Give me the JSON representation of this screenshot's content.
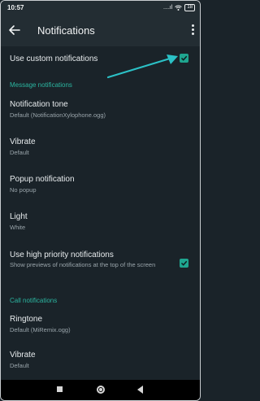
{
  "status": {
    "time": "10:57",
    "signal": "....ıl",
    "battery": "18"
  },
  "appbar": {
    "title": "Notifications"
  },
  "custom": {
    "label": "Use custom notifications",
    "checked": true
  },
  "message_section": {
    "title": "Message notifications"
  },
  "tone": {
    "label": "Notification tone",
    "value": "Default (NotificationXylophone.ogg)"
  },
  "vibrate": {
    "label": "Vibrate",
    "value": "Default"
  },
  "popup": {
    "label": "Popup notification",
    "value": "No popup"
  },
  "light": {
    "label": "Light",
    "value": "White"
  },
  "priority": {
    "label": "Use high priority notifications",
    "value": "Show previews of notifications at the top of the screen",
    "checked": true
  },
  "call_section": {
    "title": "Call notifications"
  },
  "ringtone": {
    "label": "Ringtone",
    "value": "Default (MiRemix.ogg)"
  },
  "call_vibrate": {
    "label": "Vibrate",
    "value": "Default"
  },
  "colors": {
    "accent": "#1fa58f",
    "annotation_arrow": "#2bc1c6",
    "background": "#1a2329",
    "appbar": "#232d33"
  },
  "icons": [
    "back-arrow-icon",
    "more-vert-icon",
    "checkbox-checked-icon",
    "wifi-icon",
    "battery-icon",
    "nav-recents-icon",
    "nav-home-icon",
    "nav-back-icon"
  ]
}
